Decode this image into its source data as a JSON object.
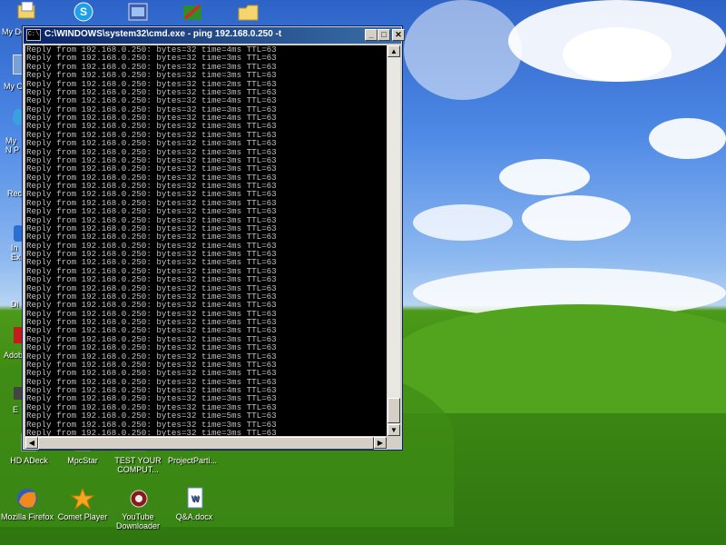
{
  "window": {
    "title": "C:\\WINDOWS\\system32\\cmd.exe - ping 192.168.0.250 -t",
    "icon_text": "C:\\",
    "controls": {
      "minimize": "_",
      "maximize": "□",
      "close": "✕"
    }
  },
  "console_lines": [
    "Reply from 192.168.0.250: bytes=32 time=4ms TTL=63",
    "Reply from 192.168.0.250: bytes=32 time=3ms TTL=63",
    "Reply from 192.168.0.250: bytes=32 time=3ms TTL=63",
    "Reply from 192.168.0.250: bytes=32 time=3ms TTL=63",
    "Reply from 192.168.0.250: bytes=32 time=2ms TTL=63",
    "Reply from 192.168.0.250: bytes=32 time=3ms TTL=63",
    "Reply from 192.168.0.250: bytes=32 time=4ms TTL=63",
    "Reply from 192.168.0.250: bytes=32 time=3ms TTL=63",
    "Reply from 192.168.0.250: bytes=32 time=4ms TTL=63",
    "Reply from 192.168.0.250: bytes=32 time=3ms TTL=63",
    "Reply from 192.168.0.250: bytes=32 time=3ms TTL=63",
    "Reply from 192.168.0.250: bytes=32 time=3ms TTL=63",
    "Reply from 192.168.0.250: bytes=32 time=3ms TTL=63",
    "Reply from 192.168.0.250: bytes=32 time=3ms TTL=63",
    "Reply from 192.168.0.250: bytes=32 time=3ms TTL=63",
    "Reply from 192.168.0.250: bytes=32 time=3ms TTL=63",
    "Reply from 192.168.0.250: bytes=32 time=3ms TTL=63",
    "Reply from 192.168.0.250: bytes=32 time=3ms TTL=63",
    "Reply from 192.168.0.250: bytes=32 time=3ms TTL=63",
    "Reply from 192.168.0.250: bytes=32 time=3ms TTL=63",
    "Reply from 192.168.0.250: bytes=32 time=3ms TTL=63",
    "Reply from 192.168.0.250: bytes=32 time=3ms TTL=63",
    "Reply from 192.168.0.250: bytes=32 time=3ms TTL=63",
    "Reply from 192.168.0.250: bytes=32 time=4ms TTL=63",
    "Reply from 192.168.0.250: bytes=32 time=3ms TTL=63",
    "Reply from 192.168.0.250: bytes=32 time=5ms TTL=63",
    "Reply from 192.168.0.250: bytes=32 time=3ms TTL=63",
    "Reply from 192.168.0.250: bytes=32 time=3ms TTL=63",
    "Reply from 192.168.0.250: bytes=32 time=3ms TTL=63",
    "Reply from 192.168.0.250: bytes=32 time=3ms TTL=63",
    "Reply from 192.168.0.250: bytes=32 time=4ms TTL=63",
    "Reply from 192.168.0.250: bytes=32 time=3ms TTL=63",
    "Reply from 192.168.0.250: bytes=32 time=6ms TTL=63",
    "Reply from 192.168.0.250: bytes=32 time=3ms TTL=63",
    "Reply from 192.168.0.250: bytes=32 time=3ms TTL=63",
    "Reply from 192.168.0.250: bytes=32 time=3ms TTL=63",
    "Reply from 192.168.0.250: bytes=32 time=3ms TTL=63",
    "Reply from 192.168.0.250: bytes=32 time=3ms TTL=63",
    "Reply from 192.168.0.250: bytes=32 time=3ms TTL=63",
    "Reply from 192.168.0.250: bytes=32 time=3ms TTL=63",
    "Reply from 192.168.0.250: bytes=32 time=4ms TTL=63",
    "Reply from 192.168.0.250: bytes=32 time=3ms TTL=63",
    "Reply from 192.168.0.250: bytes=32 time=3ms TTL=63",
    "Reply from 192.168.0.250: bytes=32 time=5ms TTL=63",
    "Reply from 192.168.0.250: bytes=32 time=3ms TTL=63",
    "Reply from 192.168.0.250: bytes=32 time=3ms TTL=63",
    "Reply from 192.168.0.250: bytes=32 time=3ms TTL=63",
    "Reply from 192.168.0.250: bytes=32 time=4ms TTL=63",
    "Reply from 192.168.0.250: bytes=32 time=5ms TTL=63",
    "Reply from 192.168.0.250: bytes=32 time=3ms TTL=63",
    "Reply from 192.168.0.250: bytes=32 time=4ms TTL=63"
  ],
  "desktop_icons": [
    {
      "label": "HD ADeck",
      "icon": "app-icon"
    },
    {
      "label": "MpcStar",
      "icon": "media-player-icon"
    },
    {
      "label": "TEST YOUR COMPUT...",
      "icon": "shortcut-icon"
    },
    {
      "label": "ProjectParti...",
      "icon": "shortcut-icon"
    },
    {
      "label": "Mozilla Firefox",
      "icon": "firefox-icon"
    },
    {
      "label": "Comet Player",
      "icon": "comet-player-icon"
    },
    {
      "label": "YouTube Downloader",
      "icon": "youtube-downloader-icon"
    },
    {
      "label": "Q&A.docx",
      "icon": "word-document-icon"
    }
  ],
  "partial_labels": [
    "My Do",
    "My C",
    "My N P",
    "Rec",
    "In Ex",
    "Di",
    "Adob",
    "E"
  ],
  "colors": {
    "console_bg": "#000000",
    "console_text": "#c0c0c0",
    "titlebar": "#0a246a"
  }
}
